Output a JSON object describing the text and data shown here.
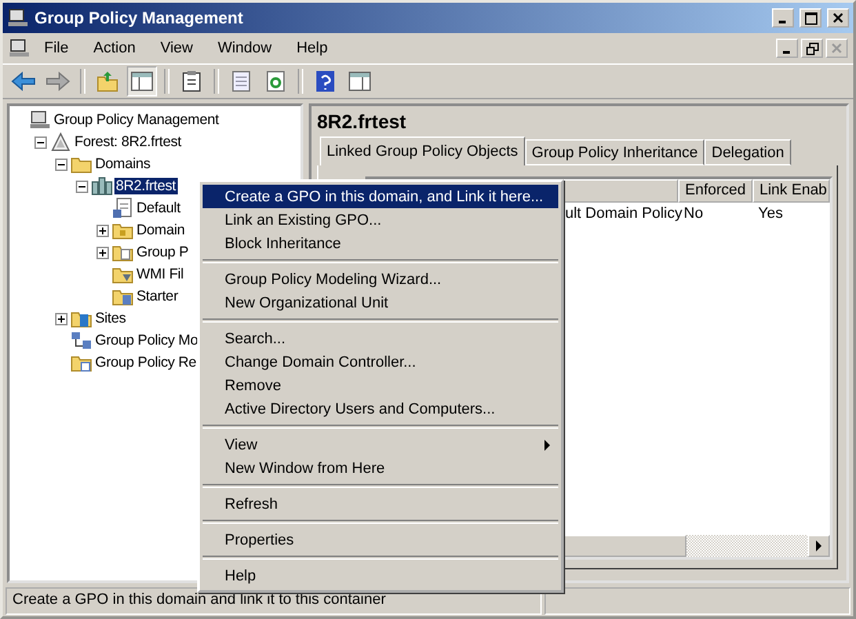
{
  "window": {
    "title": "Group Policy Management"
  },
  "menubar": [
    "File",
    "Action",
    "View",
    "Window",
    "Help"
  ],
  "tree": [
    {
      "label": "Group Policy Management",
      "kind": "console",
      "selected": false,
      "children": [
        {
          "label": "Forest: 8R2.frtest",
          "kind": "forest",
          "expanded": true,
          "selected": false,
          "children": [
            {
              "label": "Domains",
              "kind": "folder",
              "expanded": true,
              "selected": false,
              "children": [
                {
                  "label": "8R2.frtest",
                  "kind": "domain",
                  "expanded": true,
                  "selected": true,
                  "children": [
                    {
                      "label": "Default",
                      "kind": "gpo",
                      "selected": false
                    },
                    {
                      "label": "Domain",
                      "kind": "ou",
                      "expanded": false,
                      "selected": false
                    },
                    {
                      "label": "Group P",
                      "kind": "gpofolder",
                      "expanded": false,
                      "selected": false
                    },
                    {
                      "label": "WMI Fil",
                      "kind": "wmi",
                      "selected": false
                    },
                    {
                      "label": "Starter",
                      "kind": "starter",
                      "selected": false
                    }
                  ]
                }
              ]
            },
            {
              "label": "Sites",
              "kind": "sites",
              "expanded": false,
              "selected": false
            },
            {
              "label": "Group Policy Mo",
              "kind": "modeling",
              "selected": false
            },
            {
              "label": "Group Policy Re",
              "kind": "results",
              "selected": false
            }
          ]
        }
      ]
    }
  ],
  "details": {
    "heading": "8R2.frtest",
    "tabs": [
      {
        "label": "Linked Group Policy Objects",
        "selected": true
      },
      {
        "label": "Group Policy Inheritance",
        "selected": false
      },
      {
        "label": "Delegation",
        "selected": false
      }
    ],
    "table": {
      "columns": [
        "",
        "Enforced",
        "Link Enab"
      ],
      "rows": [
        [
          "ult Domain Policy",
          "No",
          "Yes"
        ]
      ]
    }
  },
  "context_menu": [
    {
      "kind": "item",
      "label": "Create a GPO in this domain, and Link it here...",
      "selected": true,
      "submenu": false
    },
    {
      "kind": "item",
      "label": "Link an Existing GPO...",
      "selected": false,
      "submenu": false
    },
    {
      "kind": "item",
      "label": "Block Inheritance",
      "selected": false,
      "submenu": false
    },
    {
      "kind": "separator"
    },
    {
      "kind": "item",
      "label": "Group Policy Modeling Wizard...",
      "selected": false,
      "submenu": false
    },
    {
      "kind": "item",
      "label": "New Organizational Unit",
      "selected": false,
      "submenu": false
    },
    {
      "kind": "separator"
    },
    {
      "kind": "item",
      "label": "Search...",
      "selected": false,
      "submenu": false
    },
    {
      "kind": "item",
      "label": "Change Domain Controller...",
      "selected": false,
      "submenu": false
    },
    {
      "kind": "item",
      "label": "Remove",
      "selected": false,
      "submenu": false
    },
    {
      "kind": "item",
      "label": "Active Directory Users and Computers...",
      "selected": false,
      "submenu": false
    },
    {
      "kind": "separator"
    },
    {
      "kind": "item",
      "label": "View",
      "selected": false,
      "submenu": true
    },
    {
      "kind": "item",
      "label": "New Window from Here",
      "selected": false,
      "submenu": false
    },
    {
      "kind": "separator"
    },
    {
      "kind": "item",
      "label": "Refresh",
      "selected": false,
      "submenu": false
    },
    {
      "kind": "separator"
    },
    {
      "kind": "item",
      "label": "Properties",
      "selected": false,
      "submenu": false
    },
    {
      "kind": "separator"
    },
    {
      "kind": "item",
      "label": "Help",
      "selected": false,
      "submenu": false
    }
  ],
  "status_bar": "Create a GPO in this domain and link it to this container"
}
